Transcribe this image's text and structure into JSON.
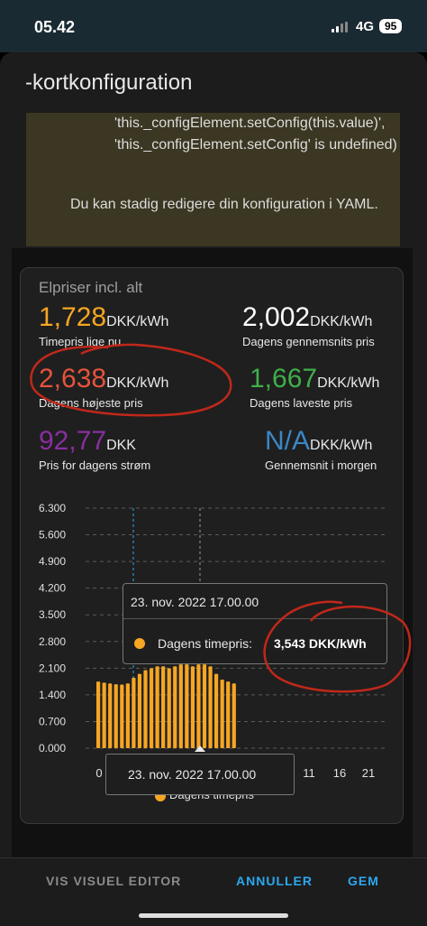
{
  "status": {
    "time": "05.42",
    "network": "4G",
    "battery": "95"
  },
  "dialog": {
    "title": "-kortkonfiguration",
    "warning_code": "'this._configElement.setConfig(this.value)', 'this._configElement.setConfig' is undefined)",
    "warning_message": "Du kan stadig redigere din konfiguration i YAML."
  },
  "card": {
    "title": "Elpriser incl. alt",
    "stats": {
      "current": {
        "value": "1,728",
        "unit": "DKK/kWh",
        "label": "Timepris lige nu",
        "color": "#f6a623"
      },
      "average": {
        "value": "2,002",
        "unit": "DKK/kWh",
        "label": "Dagens gennemsnits pris",
        "color": "#ffffff"
      },
      "highest": {
        "value": "2,638",
        "unit": "DKK/kWh",
        "label": "Dagens højeste pris",
        "color": "#e5533d"
      },
      "lowest": {
        "value": "1,667",
        "unit": "DKK/kWh",
        "label": "Dagens laveste pris",
        "color": "#3fae49"
      },
      "total": {
        "value": "92,77",
        "unit": "DKK",
        "label": "Pris for dagens strøm",
        "color": "#8a2ea0"
      },
      "tomorrow": {
        "value": "N/A",
        "unit": "DKK/kWh",
        "label": "Gennemsnit i morgen",
        "color": "#3b87c6"
      }
    }
  },
  "chart_data": {
    "type": "bar",
    "y_ticks": [
      "6.300",
      "5.600",
      "4.900",
      "4.200",
      "3.500",
      "2.800",
      "2.100",
      "1.400",
      "0.700",
      "0.000"
    ],
    "ylim": [
      0,
      6.3
    ],
    "x_ticks": [
      "0",
      "11",
      "16",
      "21"
    ],
    "series": [
      {
        "name": "Dagens timepris",
        "color": "#f6a623",
        "values": [
          1.75,
          1.72,
          1.7,
          1.68,
          1.67,
          1.7,
          1.85,
          1.95,
          2.05,
          2.1,
          2.15,
          2.15,
          2.1,
          2.15,
          2.2,
          2.2,
          2.15,
          2.2,
          2.2,
          2.15,
          1.95,
          1.8,
          1.75,
          1.7
        ]
      }
    ],
    "tooltip": {
      "date": "23. nov. 2022 17.00.00",
      "series": "Dagens timepris:",
      "value": "3,543 DKK/kWh"
    },
    "x_tooltip": "23. nov. 2022 17.00.00",
    "legend_partial": "Dagens timepris"
  },
  "footer": {
    "visual_editor": "VIS VISUEL EDITOR",
    "cancel": "ANNULLER",
    "save": "GEM"
  }
}
